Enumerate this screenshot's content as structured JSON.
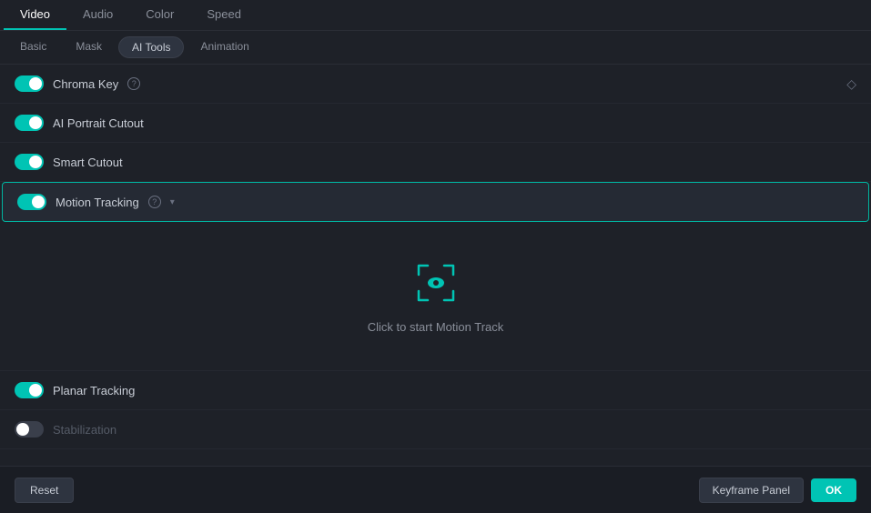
{
  "topTabs": {
    "items": [
      {
        "label": "Video",
        "active": true
      },
      {
        "label": "Audio",
        "active": false
      },
      {
        "label": "Color",
        "active": false
      },
      {
        "label": "Speed",
        "active": false
      }
    ]
  },
  "subTabs": {
    "items": [
      {
        "label": "Basic",
        "active": false
      },
      {
        "label": "Mask",
        "active": false
      },
      {
        "label": "AI Tools",
        "active": true
      },
      {
        "label": "Animation",
        "active": false
      }
    ]
  },
  "toggles": [
    {
      "id": "chroma-key",
      "label": "Chroma Key",
      "enabled": true,
      "hasHelp": true,
      "hasDiamond": true,
      "dimmed": false
    },
    {
      "id": "ai-portrait",
      "label": "AI Portrait Cutout",
      "enabled": true,
      "hasHelp": false,
      "hasDiamond": false,
      "dimmed": false
    },
    {
      "id": "smart-cutout",
      "label": "Smart Cutout",
      "enabled": true,
      "hasHelp": false,
      "hasDiamond": false,
      "dimmed": false
    },
    {
      "id": "motion-tracking",
      "label": "Motion Tracking",
      "enabled": true,
      "hasHelp": true,
      "hasChevron": true,
      "highlighted": true,
      "dimmed": false
    }
  ],
  "motionTrack": {
    "label": "Click to start Motion Track"
  },
  "planarTracking": {
    "label": "Planar Tracking",
    "enabled": true
  },
  "stabilization": {
    "label": "Stabilization",
    "enabled": false,
    "dimmed": true
  },
  "bottomBar": {
    "resetLabel": "Reset",
    "keyframeLabel": "Keyframe Panel",
    "okLabel": "OK"
  },
  "colors": {
    "accent": "#00c4b4",
    "toggleOn": "#00c4b4",
    "toggleOff": "#3a3f4b"
  }
}
